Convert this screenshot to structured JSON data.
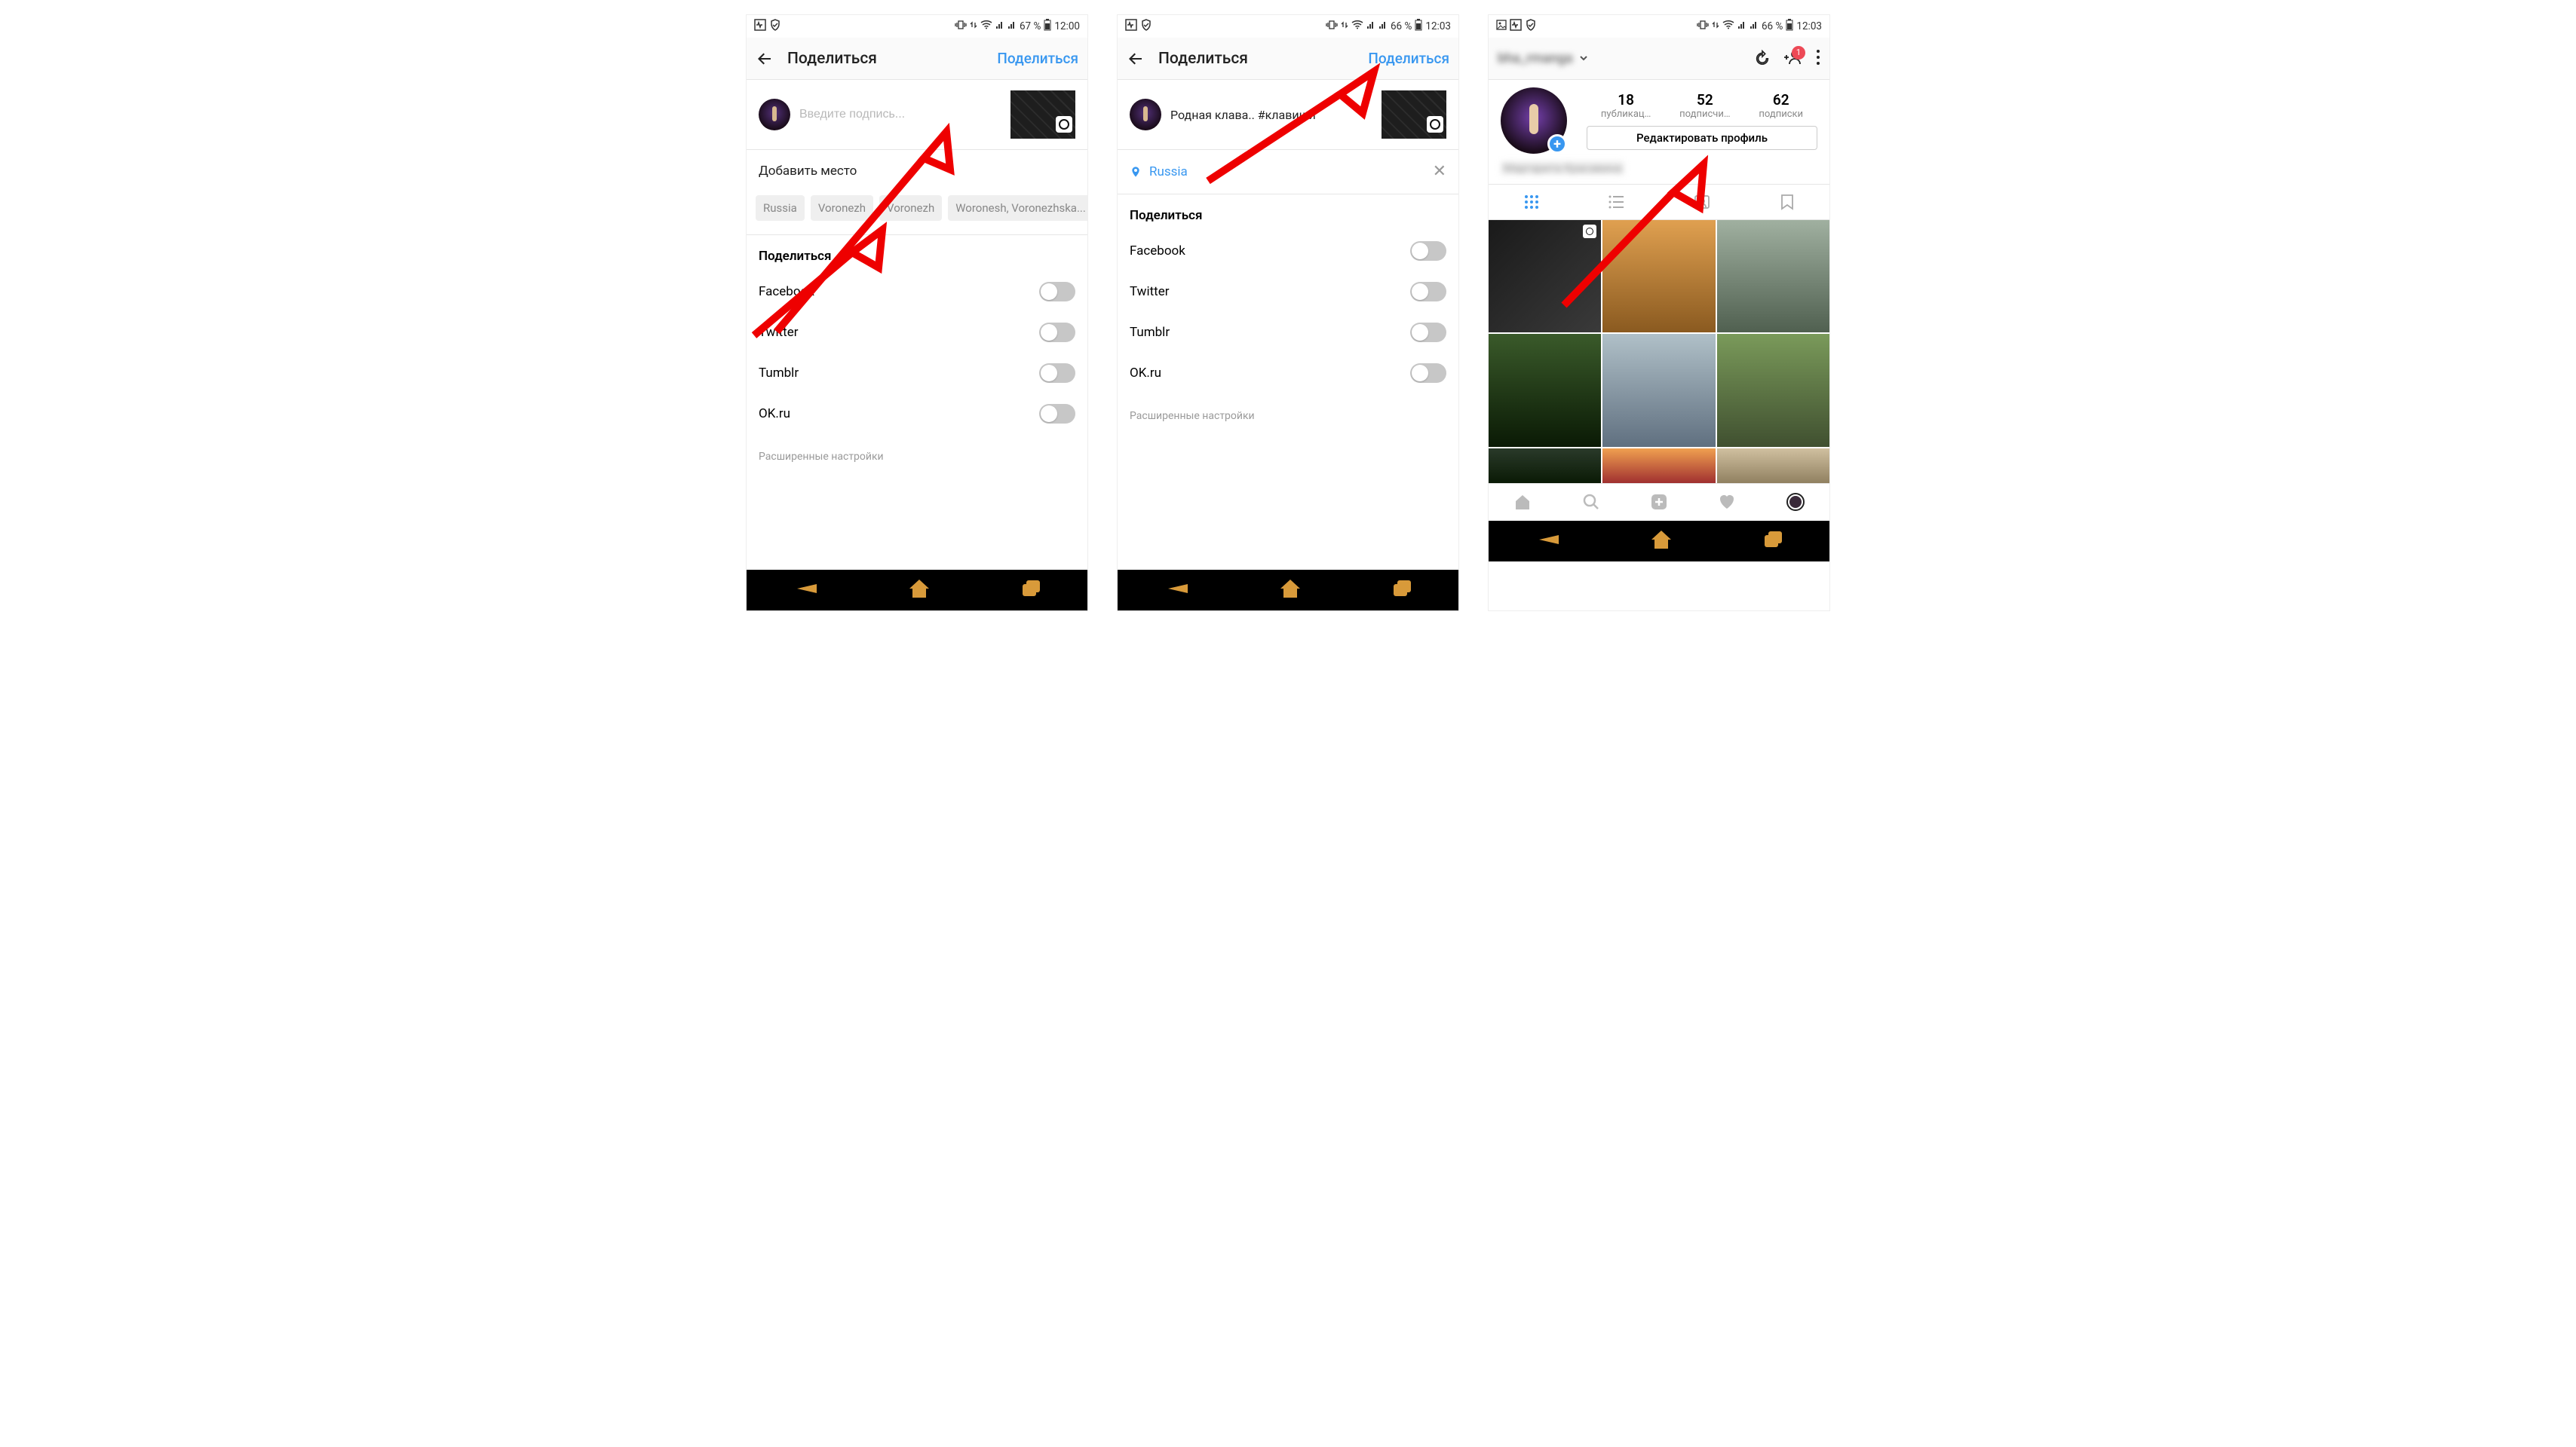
{
  "screens": [
    {
      "status": {
        "battery": "67 %",
        "time": "12:00"
      },
      "title": "Поделиться",
      "action": "Поделиться",
      "caption_placeholder": "Введите подпись...",
      "add_place": "Добавить место",
      "chips": [
        "Russia",
        "Voronezh",
        "Voronezh",
        "Woronesh, Voronezhska..."
      ],
      "share_header": "Поделиться",
      "share_targets": [
        "Facebook",
        "Twitter",
        "Tumblr",
        "OK.ru"
      ],
      "advanced": "Расширенные настройки"
    },
    {
      "status": {
        "battery": "66 %",
        "time": "12:03"
      },
      "title": "Поделиться",
      "action": "Поделиться",
      "caption_text": "Родная клава.. #клавиши",
      "location_selected": "Russia",
      "share_header": "Поделиться",
      "share_targets": [
        "Facebook",
        "Twitter",
        "Tumblr",
        "OK.ru"
      ],
      "advanced": "Расширенные настройки"
    },
    {
      "status": {
        "battery": "66 %",
        "time": "12:03"
      },
      "username_blurred": "bha_rmanga",
      "notif_count": "1",
      "stats": {
        "posts": {
          "num": "18",
          "lbl": "публикац…"
        },
        "followers": {
          "num": "52",
          "lbl": "подписчи…"
        },
        "following": {
          "num": "62",
          "lbl": "подписки"
        }
      },
      "edit_profile": "Редактировать профиль",
      "display_name_blurred": "Маргарита Красавина"
    }
  ]
}
